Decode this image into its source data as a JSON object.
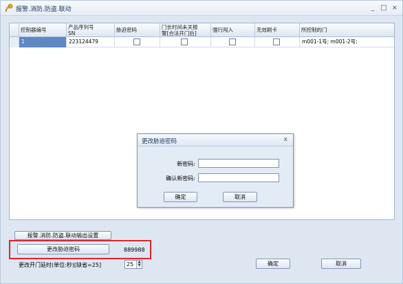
{
  "window": {
    "title": "报警.消防.防盗.联动",
    "minimize": "_",
    "maximize": "□",
    "close": "×"
  },
  "table": {
    "columns": [
      {
        "label": "控制器编号"
      },
      {
        "label": "产品序列号",
        "sub": "SN"
      },
      {
        "label": "胁迫密码"
      },
      {
        "label": "门长时间未关报",
        "sub": "警[合法开门后]"
      },
      {
        "label": "强行闯入"
      },
      {
        "label": "无效刷卡"
      },
      {
        "label": "所控制的门"
      }
    ],
    "rows": [
      {
        "controller_no": "1",
        "sn": "223124479",
        "duress_pwd": false,
        "door_open_alarm": false,
        "forced_entry": false,
        "invalid_card": false,
        "doors": "m001-1号;   m001-2号;"
      }
    ]
  },
  "dialog": {
    "title": "更改胁迫密码",
    "close": "x",
    "new_password_label": "新密码:",
    "confirm_password_label": "确认新密码:",
    "new_password_value": "",
    "confirm_password_value": "",
    "ok_label": "确定",
    "cancel_label": "取消"
  },
  "bottom": {
    "linkage_settings_label": "报警.消防.防盗.联动输出设置",
    "change_duress_label": "更改胁迫密码",
    "duress_value": "889988",
    "door_delay_label": "更改开门延时(单位:秒)[缺省=25]",
    "door_delay_value": "25",
    "spin_up": "▲",
    "spin_down": "▼",
    "ok_label": "确定",
    "cancel_label": "取消"
  },
  "colors": {
    "selected_cell": "#5f87c4",
    "highlight_box": "#e0252a"
  }
}
